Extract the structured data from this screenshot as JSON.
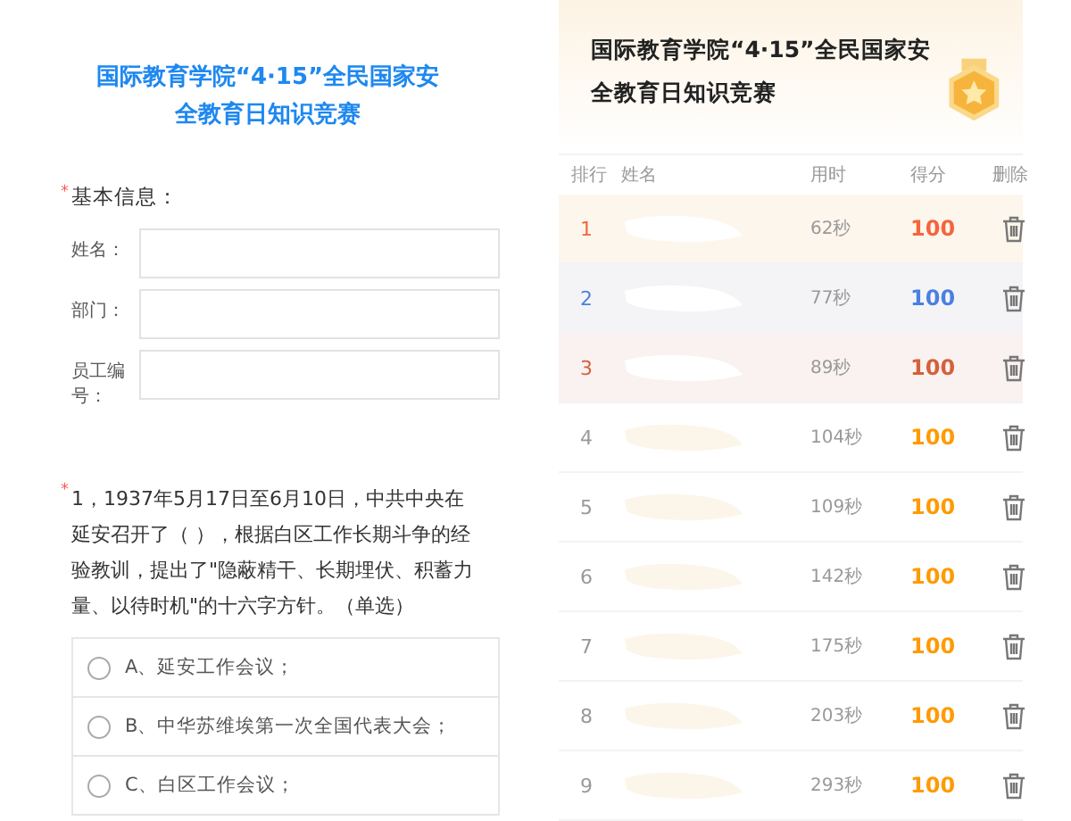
{
  "form": {
    "title": "国际教育学院“4·15”全民国家安全教育日知识竞赛",
    "basic_info": {
      "label": "基本信息：",
      "required_mark": "*",
      "fields": [
        {
          "label": "姓名："
        },
        {
          "label": "部门："
        },
        {
          "label": "员工编号："
        }
      ]
    },
    "question": {
      "required_mark": "*",
      "text": "1，1937年5月17日至6月10日，中共中央在延安召开了（ ），根据白区工作长期斗争的经验教训，提出了\"隐蔽精干、长期埋伏、积蓄力量、以待时机\"的十六字方针。（单选）",
      "options": [
        {
          "label": "A、延安工作会议；",
          "selected": false
        },
        {
          "label": "B、中华苏维埃第一次全国代表大会；",
          "selected": false
        },
        {
          "label": "C、白区工作会议；",
          "selected": false
        }
      ]
    }
  },
  "leaderboard": {
    "title": "国际教育学院“4·15”全民国家安全教育日知识竞赛",
    "columns": [
      "排行",
      "姓名",
      "用时",
      "得分",
      "删除"
    ],
    "rows": [
      {
        "rank": "1",
        "time": "62秒",
        "score": "100",
        "color": "#f5643c"
      },
      {
        "rank": "2",
        "time": "77秒",
        "score": "100",
        "color": "#4a80e0"
      },
      {
        "rank": "3",
        "time": "89秒",
        "score": "100",
        "color": "#d5603a"
      },
      {
        "rank": "4",
        "time": "104秒",
        "score": "100",
        "color": "#ff9a00"
      },
      {
        "rank": "5",
        "time": "109秒",
        "score": "100",
        "color": "#ff9a00"
      },
      {
        "rank": "6",
        "time": "142秒",
        "score": "100",
        "color": "#ff9a00"
      },
      {
        "rank": "7",
        "time": "175秒",
        "score": "100",
        "color": "#ff9a00"
      },
      {
        "rank": "8",
        "time": "203秒",
        "score": "100",
        "color": "#ff9a00"
      },
      {
        "rank": "9",
        "time": "293秒",
        "score": "100",
        "color": "#ff9a00"
      }
    ]
  }
}
